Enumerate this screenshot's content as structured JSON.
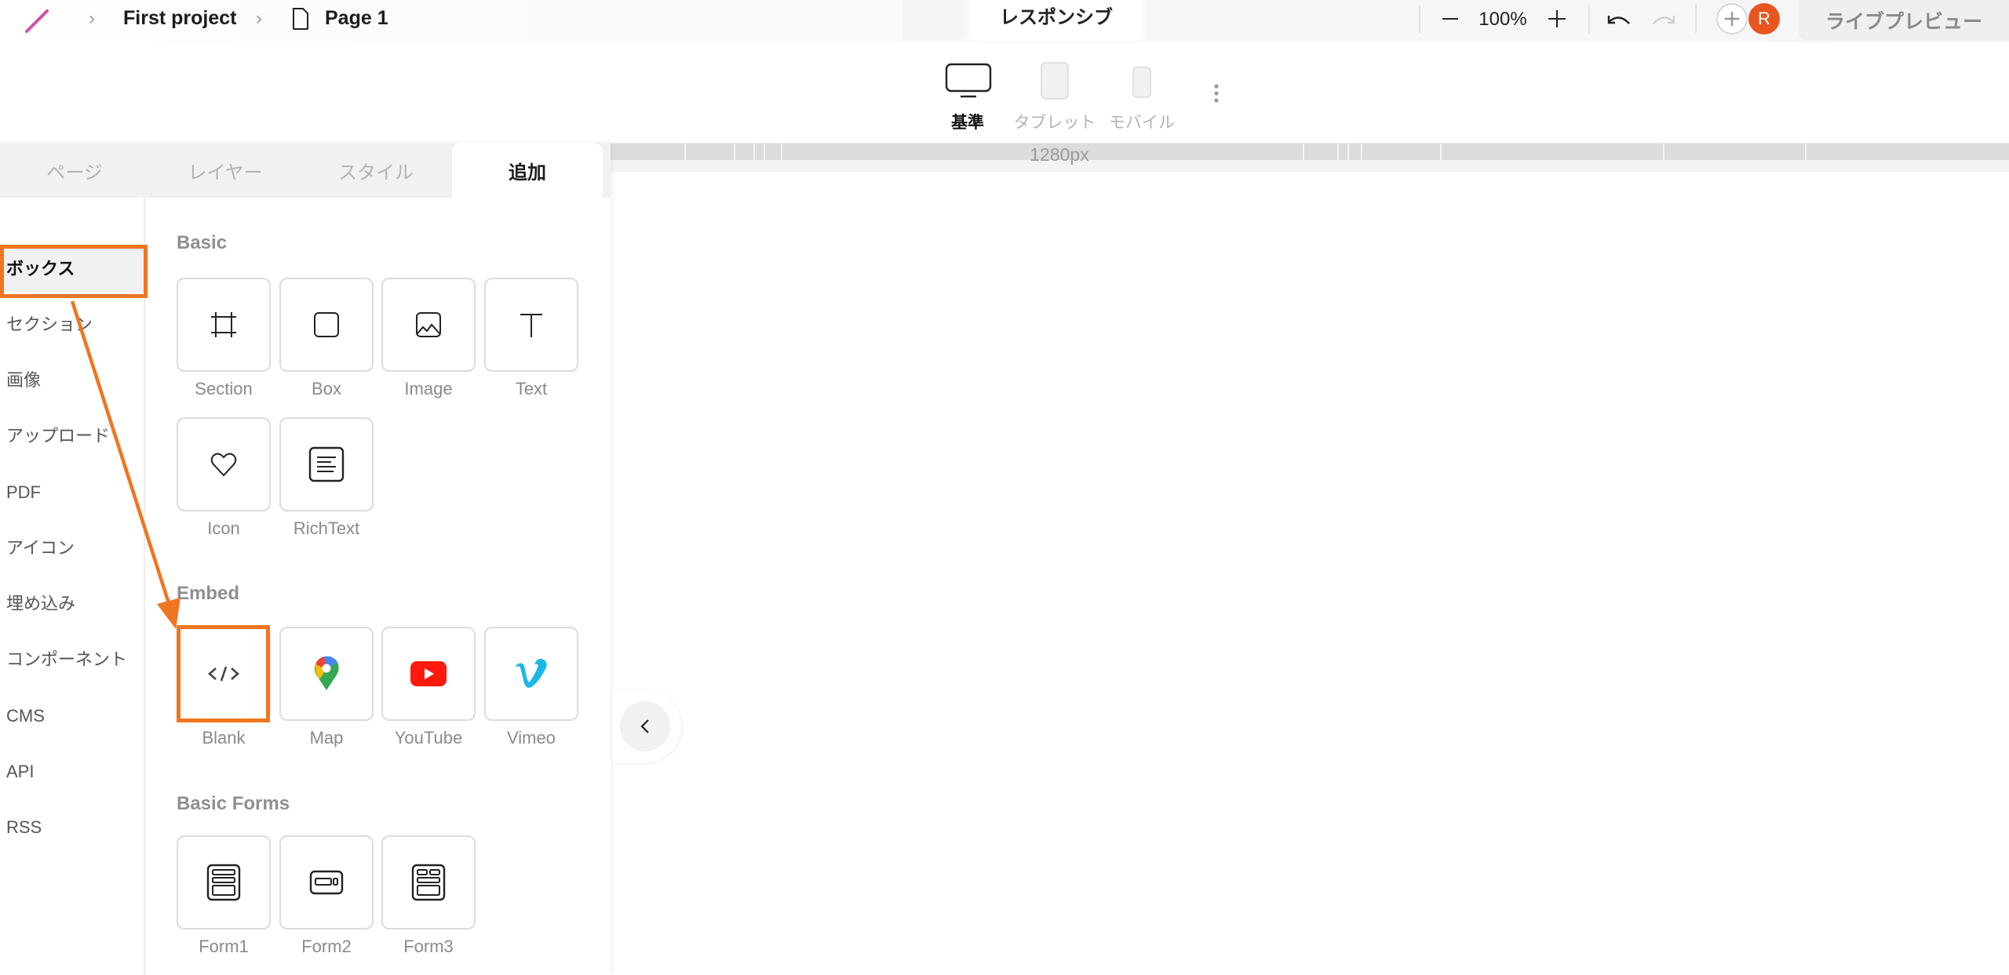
{
  "header": {
    "project_name": "First project",
    "page_name": "Page 1",
    "mode_tab": "レスポンシブ",
    "zoom_level": "100%",
    "avatar_initial": "R",
    "live_preview_label": "ライブプレビュー"
  },
  "devices": [
    {
      "label": "基準",
      "active": true
    },
    {
      "label": "タブレット",
      "active": false
    },
    {
      "label": "モバイル",
      "active": false
    }
  ],
  "ruler": {
    "width_label": "1280px"
  },
  "panel": {
    "tabs": [
      {
        "label": "ページ",
        "active": false
      },
      {
        "label": "レイヤー",
        "active": false
      },
      {
        "label": "スタイル",
        "active": false
      },
      {
        "label": "追加",
        "active": true
      }
    ],
    "categories": [
      {
        "label": "ボックス",
        "active": true
      },
      {
        "label": "セクション"
      },
      {
        "label": "画像"
      },
      {
        "label": "アップロード"
      },
      {
        "label": "PDF"
      },
      {
        "label": "アイコン"
      },
      {
        "label": "埋め込み"
      },
      {
        "label": "コンポーネント"
      },
      {
        "label": "CMS"
      },
      {
        "label": "API"
      },
      {
        "label": "RSS"
      }
    ],
    "sections": {
      "basic": {
        "title": "Basic",
        "items": [
          {
            "label": "Section",
            "icon": "section-frame-icon"
          },
          {
            "label": "Box",
            "icon": "box-icon"
          },
          {
            "label": "Image",
            "icon": "image-icon"
          },
          {
            "label": "Text",
            "icon": "text-icon"
          },
          {
            "label": "Icon",
            "icon": "heart-icon"
          },
          {
            "label": "RichText",
            "icon": "richtext-icon"
          }
        ]
      },
      "embed": {
        "title": "Embed",
        "items": [
          {
            "label": "Blank",
            "icon": "code-icon"
          },
          {
            "label": "Map",
            "icon": "google-maps-pin-icon"
          },
          {
            "label": "YouTube",
            "icon": "youtube-icon"
          },
          {
            "label": "Vimeo",
            "icon": "vimeo-icon"
          }
        ]
      },
      "forms": {
        "title": "Basic Forms",
        "items": [
          {
            "label": "Form1",
            "icon": "form1-icon"
          },
          {
            "label": "Form2",
            "icon": "form2-icon"
          },
          {
            "label": "Form3",
            "icon": "form3-icon"
          }
        ]
      }
    }
  },
  "colors": {
    "accent_orange": "#f07520",
    "avatar_bg": "#e8551f",
    "youtube_red": "#ff0000",
    "vimeo_blue": "#1ab7ea"
  }
}
